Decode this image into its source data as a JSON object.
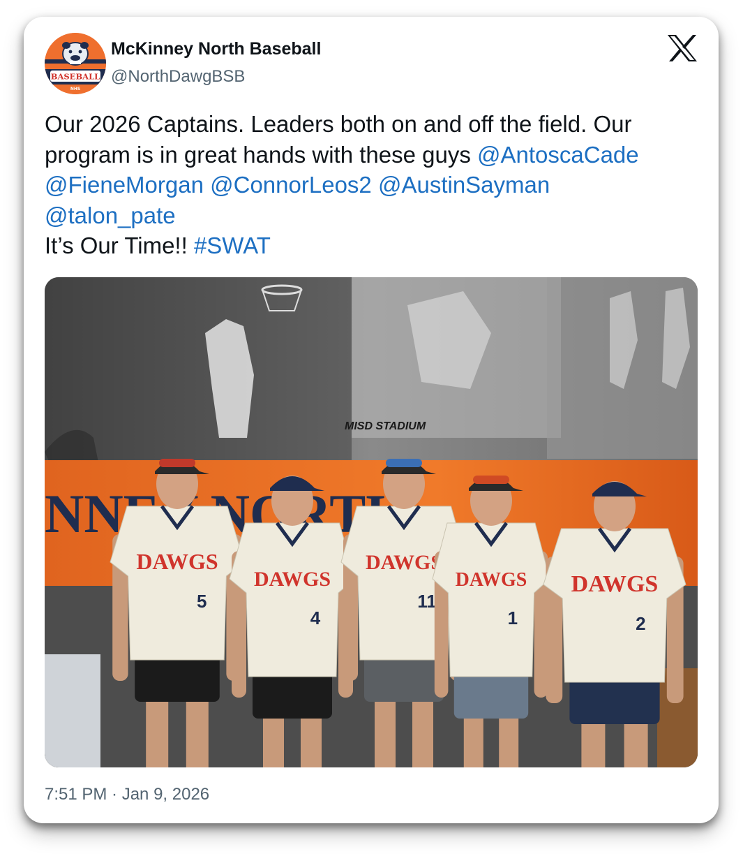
{
  "author": {
    "name": "McKinney North Baseball",
    "handle": "@NorthDawgBSB",
    "avatar_text": "BASEBALL",
    "avatar_subtext": "NHS"
  },
  "tweet": {
    "text1": "Our 2026 Captains.  Leaders both on and off the field.  Our program is in great hands with these guys ",
    "mentions": [
      "@AntoscaCade",
      "@FieneMorgan",
      "@ConnorLeos2",
      "@AustinSayman",
      "@talon_pate"
    ],
    "text2": "It’s Our Time!!  ",
    "hashtag": "#SWAT"
  },
  "photo": {
    "sign_text": "MISD STADIUM",
    "wall_text": "NNEY NORTH",
    "jersey_word": "DAWGS",
    "players": [
      {
        "number": "5"
      },
      {
        "number": "4"
      },
      {
        "number": "11"
      },
      {
        "number": "1"
      },
      {
        "number": "2"
      }
    ]
  },
  "timestamp": "7:51 PM · Jan 9, 2026",
  "colors": {
    "mention": "#1d6fc2",
    "text": "#0f1419",
    "muted": "#536471",
    "orange": "#ef6f2e",
    "navy": "#1f2d4f",
    "jersey_red": "#d0342c"
  },
  "icons": {
    "platform": "x-logo-icon"
  }
}
